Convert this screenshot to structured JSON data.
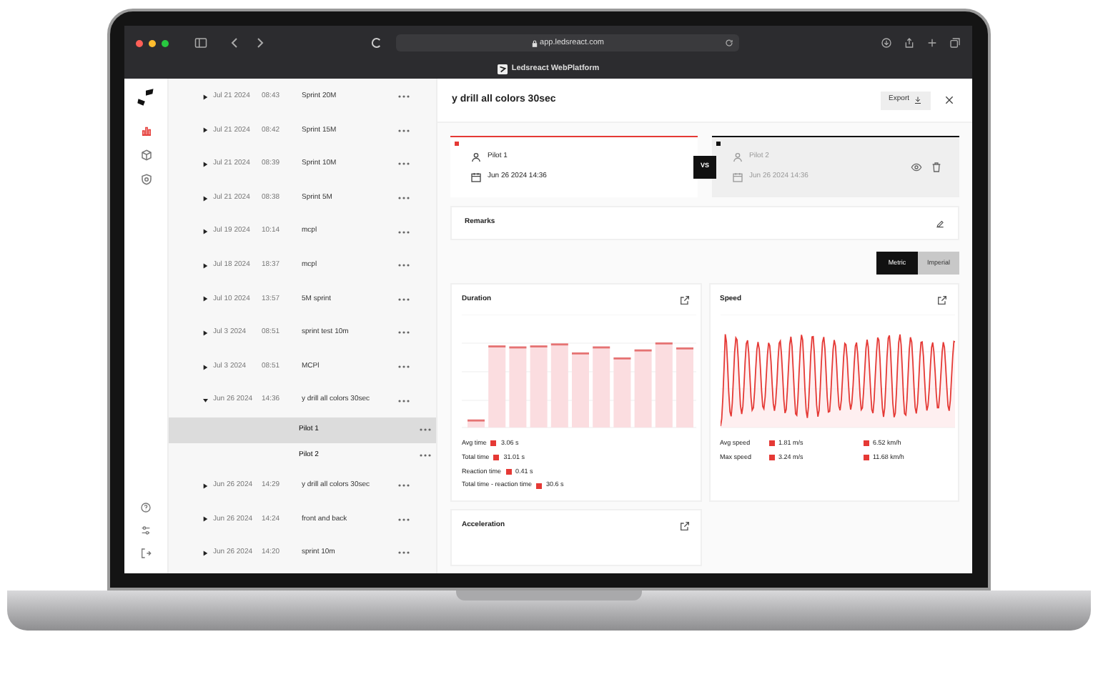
{
  "browser": {
    "url": "app.ledsreact.com",
    "tab_title": "Ledsreact WebPlatform"
  },
  "nav_items": [
    {
      "kind": "chart",
      "selected": true
    },
    {
      "kind": "box",
      "selected": false
    },
    {
      "kind": "shield",
      "selected": false
    }
  ],
  "sessions": [
    {
      "date": "Jul 21 2024",
      "time": "08:43",
      "name": "Sprint 20M",
      "expanded": false
    },
    {
      "date": "Jul 21 2024",
      "time": "08:42",
      "name": "Sprint 15M",
      "expanded": false
    },
    {
      "date": "Jul 21 2024",
      "time": "08:39",
      "name": "Sprint 10M",
      "expanded": false
    },
    {
      "date": "Jul 21 2024",
      "time": "08:38",
      "name": "Sprint 5M",
      "expanded": false
    },
    {
      "date": "Jul 19 2024",
      "time": "10:14",
      "name": "mcpl",
      "expanded": false
    },
    {
      "date": "Jul 18 2024",
      "time": "18:37",
      "name": "mcpl",
      "expanded": false
    },
    {
      "date": "Jul 10 2024",
      "time": "13:57",
      "name": "5M sprint",
      "expanded": false
    },
    {
      "date": "Jul 3 2024",
      "time": "08:51",
      "name": "sprint test 10m",
      "expanded": false
    },
    {
      "date": "Jul 3 2024",
      "time": "08:51",
      "name": "MCPl",
      "expanded": false
    },
    {
      "date": "Jun 26 2024",
      "time": "14:36",
      "name": "y drill all colors 30sec",
      "expanded": true,
      "children": [
        {
          "name": "Pilot 1",
          "selected": true
        },
        {
          "name": "Pilot 2",
          "selected": false
        }
      ]
    },
    {
      "date": "Jun 26 2024",
      "time": "14:29",
      "name": "y drill all colors 30sec",
      "expanded": false
    },
    {
      "date": "Jun 26 2024",
      "time": "14:24",
      "name": "front and back",
      "expanded": false
    },
    {
      "date": "Jun 26 2024",
      "time": "14:20",
      "name": "sprint 10m",
      "expanded": false
    }
  ],
  "detail": {
    "title": "y drill all colors 30sec",
    "export_label": "Export",
    "pilots": [
      {
        "name": "Pilot 1",
        "date": "Jun 26 2024 14:36",
        "color": "#e53935",
        "active": true
      },
      {
        "name": "Pilot 2",
        "date": "Jun 26 2024 14:36",
        "color": "#111111",
        "active": false
      }
    ],
    "vs_label": "VS",
    "remarks_title": "Remarks",
    "units": [
      {
        "label": "Metric",
        "selected": true
      },
      {
        "label": "Imperial",
        "selected": false
      }
    ],
    "duration": {
      "title": "Duration",
      "stats": [
        {
          "label": "Avg time",
          "value": "3.06 s"
        },
        {
          "label": "Total time",
          "value": "31.01 s"
        },
        {
          "label": "Reaction time",
          "value": "0.41 s"
        },
        {
          "label": "Total time - reaction time",
          "value": "30.6 s"
        }
      ]
    },
    "speed": {
      "title": "Speed",
      "stats": [
        {
          "label": "Avg speed",
          "value": "1.81 m/s",
          "value_2": "6.52 km/h"
        },
        {
          "label": "Max speed",
          "value": "3.24 m/s",
          "value_2": "11.68 km/h"
        }
      ]
    },
    "acceleration": {
      "title": "Acceleration"
    }
  }
}
